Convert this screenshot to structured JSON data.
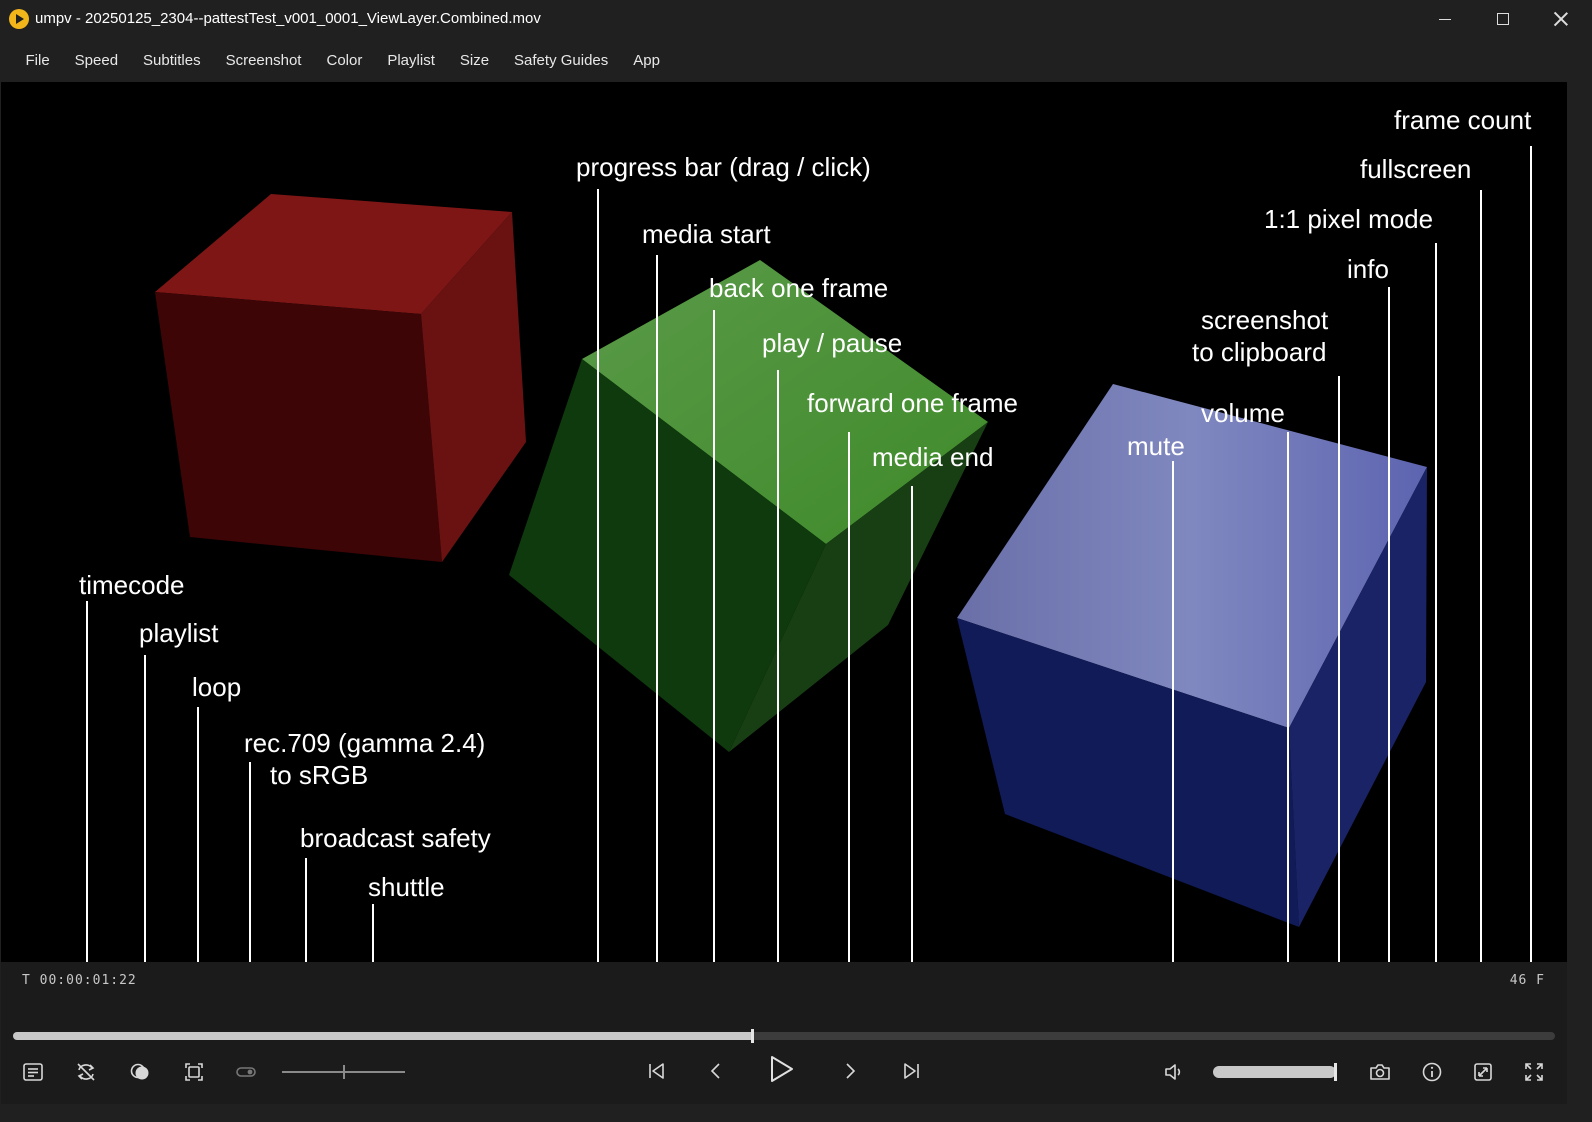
{
  "window": {
    "title": "umpv - 20250125_2304--pattestTest_v001_0001_ViewLayer.Combined.mov",
    "app_icon": "play-logo-icon"
  },
  "menu": [
    "File",
    "Speed",
    "Subtitles",
    "Screenshot",
    "Color",
    "Playlist",
    "Size",
    "Safety Guides",
    "App"
  ],
  "annotations": {
    "frame_count": "frame count",
    "fullscreen": "fullscreen",
    "pixel_mode": "1:1 pixel mode",
    "info": "info",
    "screenshot_line1": "screenshot",
    "screenshot_line2": "to clipboard",
    "volume": "volume",
    "mute": "mute",
    "progress_bar": "progress bar (drag / click)",
    "media_start": "media start",
    "back_frame": "back one frame",
    "play_pause": "play / pause",
    "forward_frame": "forward one frame",
    "media_end": "media end",
    "timecode": "timecode",
    "playlist": "playlist",
    "loop": "loop",
    "rec709_line1": "rec.709 (gamma 2.4)",
    "rec709_line2": "to sRGB",
    "broadcast_safety": "broadcast safety",
    "shuttle": "shuttle"
  },
  "controls": {
    "timecode_label": "T  00:00:01:22",
    "frame_label": "46 F",
    "progress_fraction": 0.479,
    "volume_fraction": 1.0,
    "shuttle_fraction": 0.5,
    "buttons": [
      "playlist-icon",
      "loop-off-icon",
      "color-transform-icon",
      "safety-guides-icon",
      "shuttle-toggle-icon",
      "media-start-icon",
      "back-frame-icon",
      "play-icon",
      "forward-frame-icon",
      "media-end-icon",
      "volume-icon",
      "camera-icon",
      "info-icon",
      "pixel-mode-icon",
      "fullscreen-icon"
    ]
  },
  "colors": {
    "background": "#000000",
    "chrome": "#202020",
    "controls": "#1b1b1b",
    "accent": "#f3b61a",
    "cube_red": "#7a1616",
    "cube_green": "#2a7a1c",
    "cube_blue": "#3a4a9a"
  }
}
